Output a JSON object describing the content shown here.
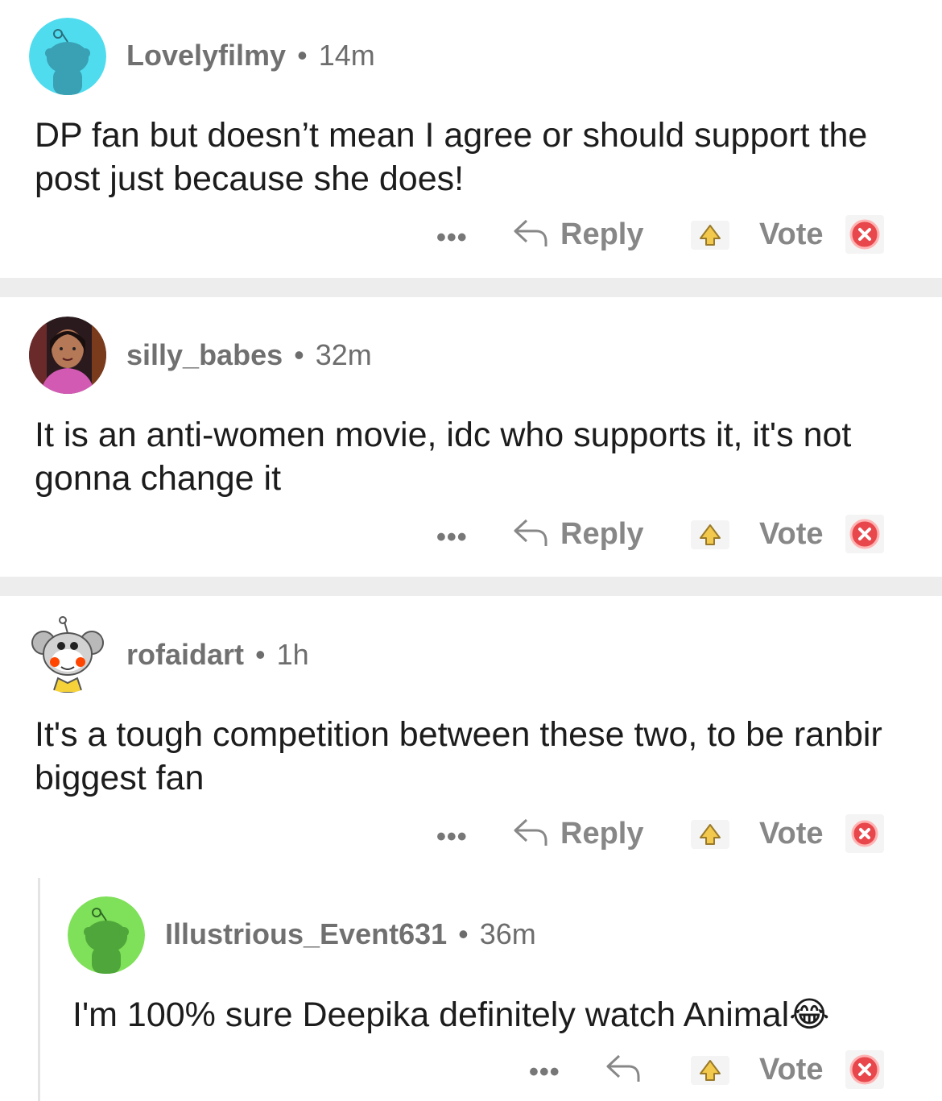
{
  "comments": [
    {
      "author": "Lovelyfilmy",
      "time": "14m",
      "text": "DP fan but doesn’t mean I agree or should support the post just because she does!",
      "avatar_color": "#4fdcef",
      "avatar_icon": "snoo-avatar-icon",
      "more": "•••",
      "reply": "Reply",
      "vote": "Vote"
    },
    {
      "author": "silly_babes",
      "time": "32m",
      "text": "It is an anti-women movie, idc who supports it, it's not gonna change it",
      "avatar_icon": "photo-avatar-icon",
      "more": "•••",
      "reply": "Reply",
      "vote": "Vote"
    },
    {
      "author": "rofaidart",
      "time": "1h",
      "text": "It's a tough  competition between these two, to be ranbir biggest fan",
      "avatar_icon": "koala-snoo-avatar-icon",
      "more": "•••",
      "reply": "Reply",
      "vote": "Vote"
    },
    {
      "author": "Illustrious_Event631",
      "time": "36m",
      "text": "I'm 100% sure Deepika definitely watch Animal",
      "emoji": "😂",
      "avatar_color": "#7fe05a",
      "avatar_icon": "snoo-avatar-icon",
      "more": "•••",
      "vote": "Vote"
    }
  ],
  "separator": "•"
}
